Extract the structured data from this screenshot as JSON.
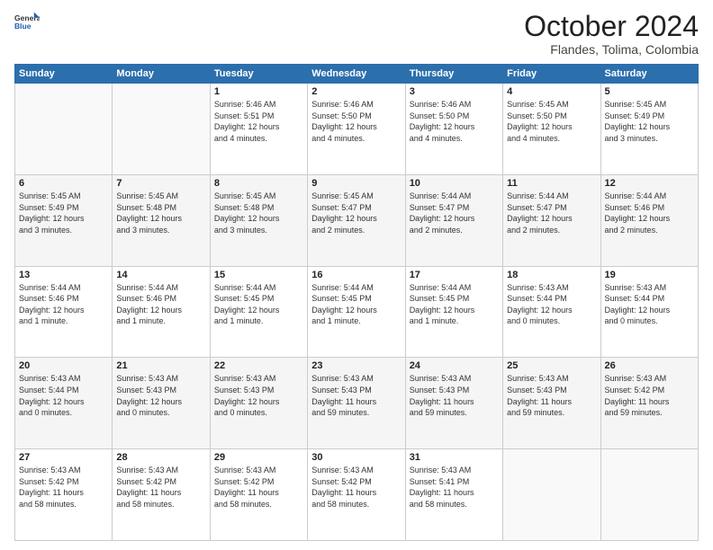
{
  "logo": {
    "line1": "General",
    "line2": "Blue"
  },
  "title": "October 2024",
  "location": "Flandes, Tolima, Colombia",
  "weekdays": [
    "Sunday",
    "Monday",
    "Tuesday",
    "Wednesday",
    "Thursday",
    "Friday",
    "Saturday"
  ],
  "weeks": [
    [
      {
        "day": "",
        "info": ""
      },
      {
        "day": "",
        "info": ""
      },
      {
        "day": "1",
        "info": "Sunrise: 5:46 AM\nSunset: 5:51 PM\nDaylight: 12 hours\nand 4 minutes."
      },
      {
        "day": "2",
        "info": "Sunrise: 5:46 AM\nSunset: 5:50 PM\nDaylight: 12 hours\nand 4 minutes."
      },
      {
        "day": "3",
        "info": "Sunrise: 5:46 AM\nSunset: 5:50 PM\nDaylight: 12 hours\nand 4 minutes."
      },
      {
        "day": "4",
        "info": "Sunrise: 5:45 AM\nSunset: 5:50 PM\nDaylight: 12 hours\nand 4 minutes."
      },
      {
        "day": "5",
        "info": "Sunrise: 5:45 AM\nSunset: 5:49 PM\nDaylight: 12 hours\nand 3 minutes."
      }
    ],
    [
      {
        "day": "6",
        "info": "Sunrise: 5:45 AM\nSunset: 5:49 PM\nDaylight: 12 hours\nand 3 minutes."
      },
      {
        "day": "7",
        "info": "Sunrise: 5:45 AM\nSunset: 5:48 PM\nDaylight: 12 hours\nand 3 minutes."
      },
      {
        "day": "8",
        "info": "Sunrise: 5:45 AM\nSunset: 5:48 PM\nDaylight: 12 hours\nand 3 minutes."
      },
      {
        "day": "9",
        "info": "Sunrise: 5:45 AM\nSunset: 5:47 PM\nDaylight: 12 hours\nand 2 minutes."
      },
      {
        "day": "10",
        "info": "Sunrise: 5:44 AM\nSunset: 5:47 PM\nDaylight: 12 hours\nand 2 minutes."
      },
      {
        "day": "11",
        "info": "Sunrise: 5:44 AM\nSunset: 5:47 PM\nDaylight: 12 hours\nand 2 minutes."
      },
      {
        "day": "12",
        "info": "Sunrise: 5:44 AM\nSunset: 5:46 PM\nDaylight: 12 hours\nand 2 minutes."
      }
    ],
    [
      {
        "day": "13",
        "info": "Sunrise: 5:44 AM\nSunset: 5:46 PM\nDaylight: 12 hours\nand 1 minute."
      },
      {
        "day": "14",
        "info": "Sunrise: 5:44 AM\nSunset: 5:46 PM\nDaylight: 12 hours\nand 1 minute."
      },
      {
        "day": "15",
        "info": "Sunrise: 5:44 AM\nSunset: 5:45 PM\nDaylight: 12 hours\nand 1 minute."
      },
      {
        "day": "16",
        "info": "Sunrise: 5:44 AM\nSunset: 5:45 PM\nDaylight: 12 hours\nand 1 minute."
      },
      {
        "day": "17",
        "info": "Sunrise: 5:44 AM\nSunset: 5:45 PM\nDaylight: 12 hours\nand 1 minute."
      },
      {
        "day": "18",
        "info": "Sunrise: 5:43 AM\nSunset: 5:44 PM\nDaylight: 12 hours\nand 0 minutes."
      },
      {
        "day": "19",
        "info": "Sunrise: 5:43 AM\nSunset: 5:44 PM\nDaylight: 12 hours\nand 0 minutes."
      }
    ],
    [
      {
        "day": "20",
        "info": "Sunrise: 5:43 AM\nSunset: 5:44 PM\nDaylight: 12 hours\nand 0 minutes."
      },
      {
        "day": "21",
        "info": "Sunrise: 5:43 AM\nSunset: 5:43 PM\nDaylight: 12 hours\nand 0 minutes."
      },
      {
        "day": "22",
        "info": "Sunrise: 5:43 AM\nSunset: 5:43 PM\nDaylight: 12 hours\nand 0 minutes."
      },
      {
        "day": "23",
        "info": "Sunrise: 5:43 AM\nSunset: 5:43 PM\nDaylight: 11 hours\nand 59 minutes."
      },
      {
        "day": "24",
        "info": "Sunrise: 5:43 AM\nSunset: 5:43 PM\nDaylight: 11 hours\nand 59 minutes."
      },
      {
        "day": "25",
        "info": "Sunrise: 5:43 AM\nSunset: 5:43 PM\nDaylight: 11 hours\nand 59 minutes."
      },
      {
        "day": "26",
        "info": "Sunrise: 5:43 AM\nSunset: 5:42 PM\nDaylight: 11 hours\nand 59 minutes."
      }
    ],
    [
      {
        "day": "27",
        "info": "Sunrise: 5:43 AM\nSunset: 5:42 PM\nDaylight: 11 hours\nand 58 minutes."
      },
      {
        "day": "28",
        "info": "Sunrise: 5:43 AM\nSunset: 5:42 PM\nDaylight: 11 hours\nand 58 minutes."
      },
      {
        "day": "29",
        "info": "Sunrise: 5:43 AM\nSunset: 5:42 PM\nDaylight: 11 hours\nand 58 minutes."
      },
      {
        "day": "30",
        "info": "Sunrise: 5:43 AM\nSunset: 5:42 PM\nDaylight: 11 hours\nand 58 minutes."
      },
      {
        "day": "31",
        "info": "Sunrise: 5:43 AM\nSunset: 5:41 PM\nDaylight: 11 hours\nand 58 minutes."
      },
      {
        "day": "",
        "info": ""
      },
      {
        "day": "",
        "info": ""
      }
    ]
  ]
}
